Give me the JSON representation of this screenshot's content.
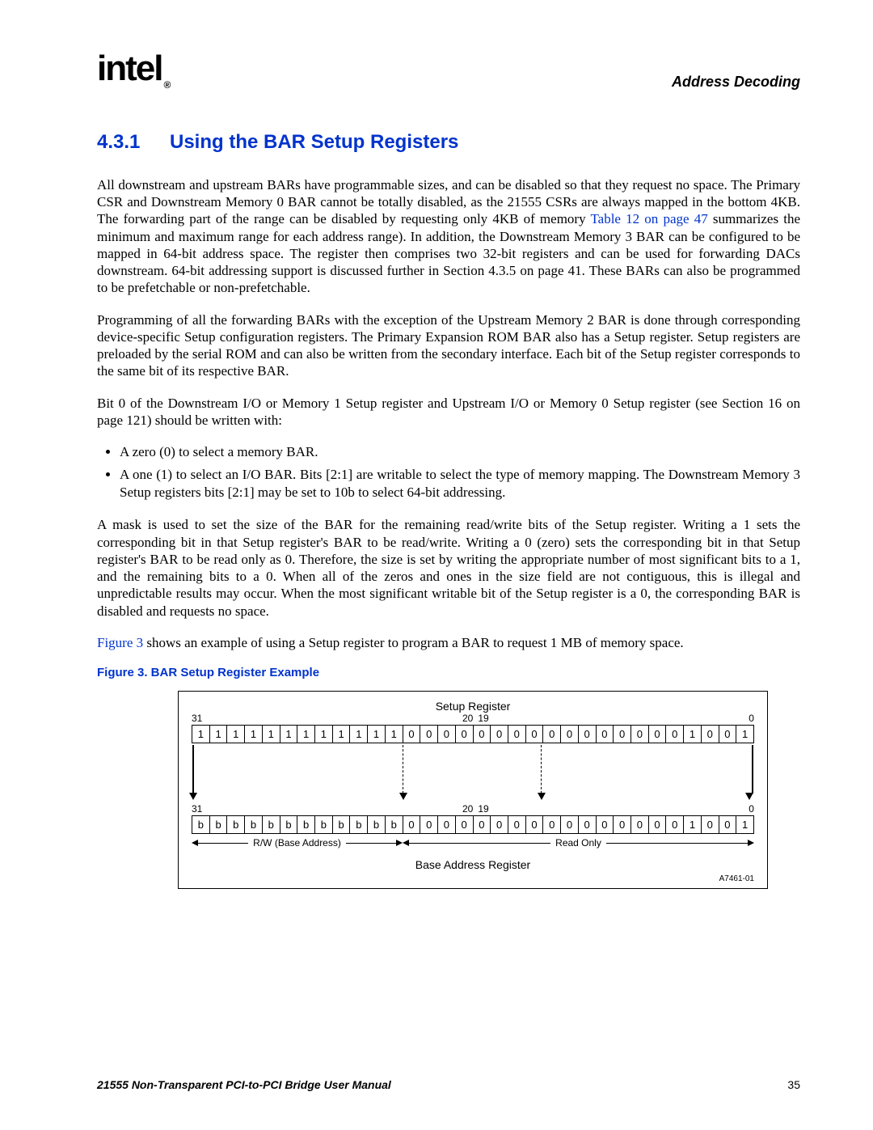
{
  "header": {
    "logo_text": "intel",
    "logo_sub": "®",
    "chapter": "Address Decoding"
  },
  "section": {
    "number": "4.3.1",
    "title": "Using the BAR Setup Registers"
  },
  "para1_a": "All downstream and upstream BARs have programmable sizes, and can be disabled so that they request no space. The Primary CSR and Downstream Memory 0 BAR cannot be totally disabled, as the 21555 CSRs are always mapped in the bottom 4KB. The forwarding part of the range can be disabled by requesting only 4KB of memory ",
  "para1_link": "Table 12 on page 47",
  "para1_b": " summarizes the minimum and maximum range for each address range). In addition, the Downstream Memory 3 BAR can be configured to be mapped in 64-bit address space. The register then comprises two 32-bit registers and can be used for forwarding DACs downstream. 64-bit addressing support is discussed further in Section 4.3.5 on page 41. These BARs can also be programmed to be prefetchable or non-prefetchable.",
  "para2": "Programming of all the forwarding BARs with the exception of the Upstream Memory 2 BAR is done through corresponding device-specific Setup configuration registers. The Primary Expansion ROM BAR also has a Setup register. Setup registers are preloaded by the serial ROM and can also be written from the secondary interface. Each bit of the Setup register corresponds to the same bit of its respective BAR.",
  "para3": "Bit 0 of the Downstream I/O or Memory 1 Setup register and Upstream I/O or Memory 0 Setup register (see Section 16 on page 121) should be written with:",
  "bullet1": "A zero (0) to select a memory BAR.",
  "bullet2": "A one (1) to select an I/O BAR. Bits [2:1] are writable to select the type of memory mapping. The Downstream Memory 3 Setup registers bits [2:1] may be set to 10b to select 64-bit addressing.",
  "para4": "A mask is used to set the size of the BAR for the remaining read/write bits of the Setup register. Writing a 1 sets the corresponding bit in that Setup register's BAR to be read/write. Writing a 0 (zero) sets the corresponding bit in that Setup register's BAR to be read only as 0. Therefore, the size is set by writing the appropriate number of most significant bits to a 1, and the remaining bits to a 0. When all of the zeros and ones in the size field are not contiguous, this is illegal and unpredictable results may occur. When the most significant writable bit of the Setup register is a 0, the corresponding BAR is disabled and requests no space.",
  "para5_link": "Figure 3",
  "para5_rest": " shows an example of using a Setup register to program a BAR to request 1 MB of memory space.",
  "figure": {
    "caption": "Figure 3.  BAR Setup Register Example",
    "setup_title": "Setup Register",
    "bits_top_left": "31",
    "bits_top_mid_a": "20",
    "bits_top_mid_b": "19",
    "bits_top_right": "0",
    "row1": [
      "1",
      "1",
      "1",
      "1",
      "1",
      "1",
      "1",
      "1",
      "1",
      "1",
      "1",
      "1",
      "0",
      "0",
      "0",
      "0",
      "0",
      "0",
      "0",
      "0",
      "0",
      "0",
      "0",
      "0",
      "0",
      "0",
      "0",
      "0",
      "1",
      "0",
      "0",
      "1"
    ],
    "row2": [
      "b",
      "b",
      "b",
      "b",
      "b",
      "b",
      "b",
      "b",
      "b",
      "b",
      "b",
      "b",
      "0",
      "0",
      "0",
      "0",
      "0",
      "0",
      "0",
      "0",
      "0",
      "0",
      "0",
      "0",
      "0",
      "0",
      "0",
      "0",
      "1",
      "0",
      "0",
      "1"
    ],
    "range_rw": "R/W (Base Address)",
    "range_ro": "Read Only",
    "base_title": "Base Address Register",
    "fig_id": "A7461-01"
  },
  "footer": {
    "title": "21555 Non-Transparent PCI-to-PCI Bridge User Manual",
    "page": "35"
  }
}
